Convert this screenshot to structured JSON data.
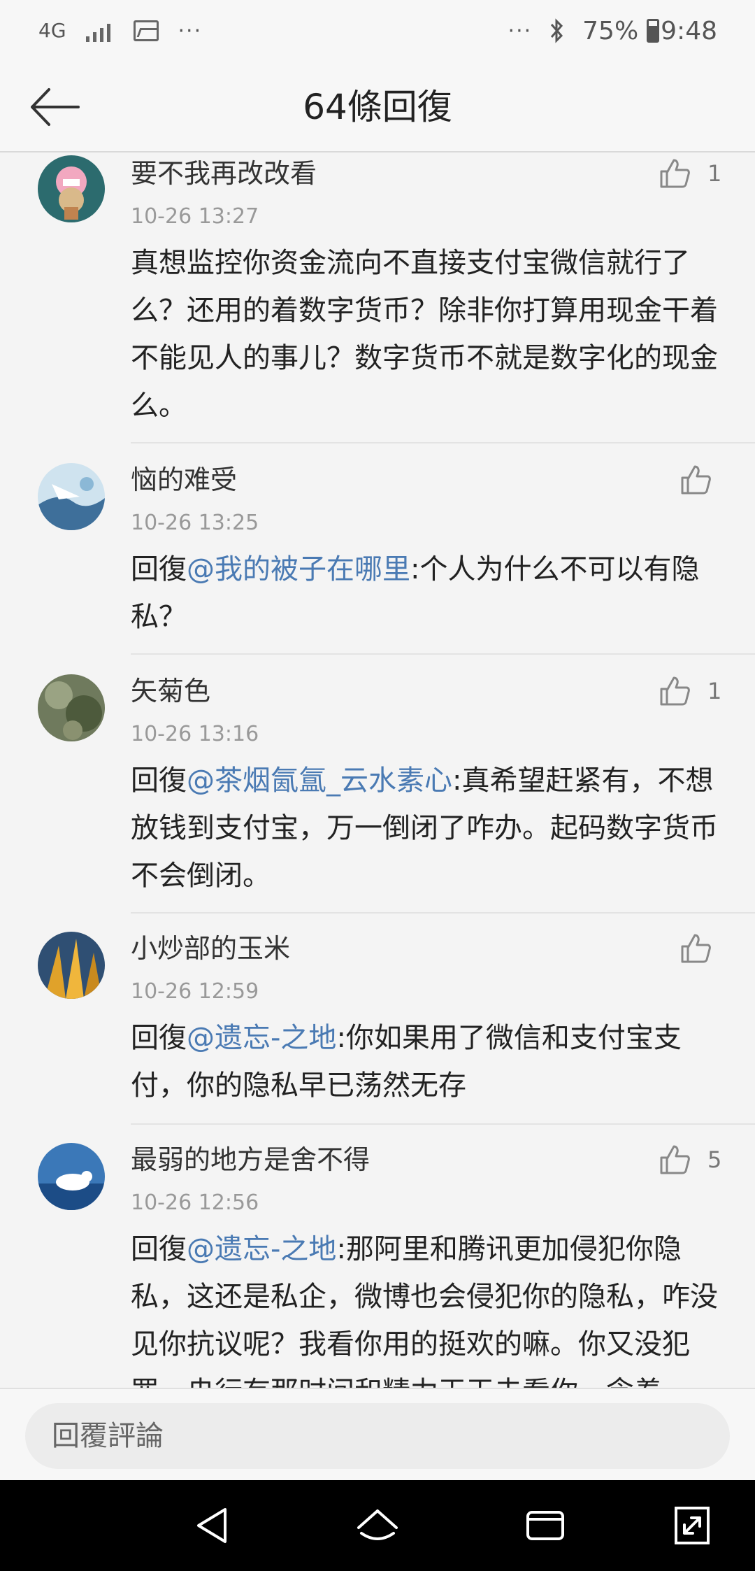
{
  "status_bar": {
    "network": "4G",
    "dots_left": "···",
    "dots_right": "···",
    "battery": "75%",
    "time": "9:48"
  },
  "header": {
    "title": "64條回復"
  },
  "comments": [
    {
      "name": "要不我再改改看",
      "time": "10-26 13:27",
      "likes": "1",
      "text": "真想监控你资金流向不直接支付宝微信就行了么？还用的着数字货币？除非你打算用现金干着不能见人的事儿？数字货币不就是数字化的现金么。"
    },
    {
      "name": "恼的难受",
      "time": "10-26 13:25",
      "likes": "",
      "reply_prefix": "回復",
      "mention": "@我的被子在哪里",
      "text": ":个人为什么不可以有隐私？"
    },
    {
      "name": "矢菊色",
      "time": "10-26 13:16",
      "likes": "1",
      "reply_prefix": "回復",
      "mention": "@茶烟氤氲_云水素心",
      "text": ":真希望赶紧有，不想放钱到支付宝，万一倒闭了咋办。起码数字货币不会倒闭。"
    },
    {
      "name": "小炒部的玉米",
      "time": "10-26 12:59",
      "likes": "",
      "reply_prefix": "回復",
      "mention": "@遗忘-之地",
      "text": ":你如果用了微信和支付宝支付，你的隐私早已荡然无存"
    },
    {
      "name": "最弱的地方是舍不得",
      "time": "10-26 12:56",
      "likes": "5",
      "reply_prefix": "回復",
      "mention": "@遗忘-之地",
      "text": ":那阿里和腾讯更加侵犯你隐私，这还是私企，微博也会侵犯你的隐私，咋没见你抗议呢？我看你用的挺欢的嘛。你又没犯罪，央行有那时间和精力天天去看你，念着"
    }
  ],
  "reply_bar": {
    "placeholder": "回覆評論"
  },
  "colors": {
    "mention": "#4a7ab3",
    "background": "#f4f4f4",
    "navbar": "#000000"
  }
}
